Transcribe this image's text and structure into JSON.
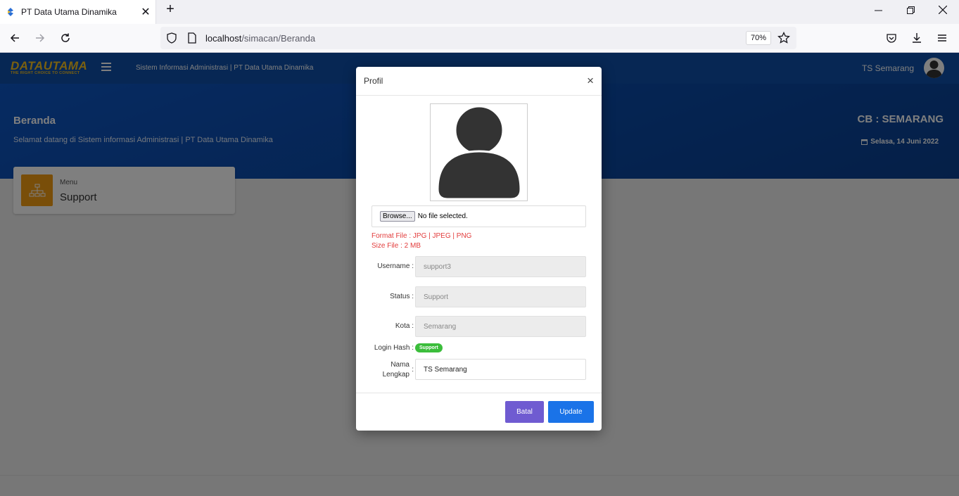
{
  "browser": {
    "tab_title": "PT Data Utama Dinamika",
    "url_host": "localhost",
    "url_path": "/simacan/Beranda",
    "zoom": "70%"
  },
  "app": {
    "brand": "DATAUTAMA",
    "brand_tagline": "THE RIGHT CHOICE TO CONNECT",
    "title": "Sistem Informasi Administrasi | PT Data Utama Dinamika",
    "user_name": "TS Semarang"
  },
  "hero": {
    "title": "Beranda",
    "subtitle": "Selamat datang di Sistem informasi Administrasi | PT Data Utama Dinamika",
    "cb": "CB : SEMARANG",
    "date": "Selasa,  14 Juni 2022"
  },
  "card": {
    "label": "Menu",
    "value": "Support"
  },
  "modal": {
    "title": "Profil",
    "close": "×",
    "file_button": "Browse...",
    "file_status": "No file selected.",
    "hint_format": "Format File : JPG | JPEG | PNG",
    "hint_size": "Size File : 2 MB",
    "username_label": "Username :",
    "username_value": "support3",
    "status_label": "Status :",
    "status_value": "Support",
    "kota_label": "Kota :",
    "kota_value": "Semarang",
    "login_hash_label": "Login Hash :",
    "login_hash_badge": "Support",
    "nama_label_1": "Nama",
    "nama_label_2": "Lengkap",
    "nama_colon": ":",
    "nama_value": "TS Semarang",
    "btn_batal": "Batal",
    "btn_update": "Update"
  },
  "colors": {
    "header_blue": "#0f4fa8",
    "batal_purple": "#6f5bd1",
    "update_blue": "#1a73e8",
    "badge_green": "#3bbd3b",
    "hint_red": "#e23c3c",
    "card_icon_orange": "#f39c12"
  }
}
